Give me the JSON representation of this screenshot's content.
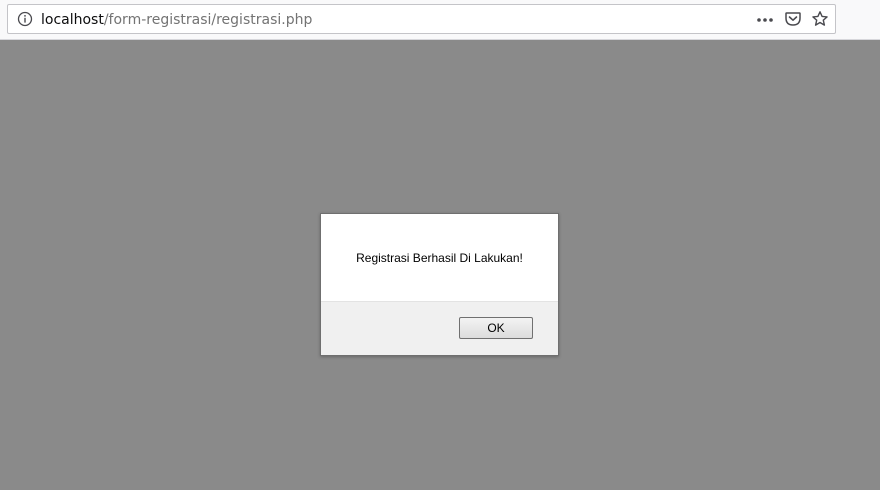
{
  "browser": {
    "url_host": "localhost",
    "url_path": "/form-registrasi/registrasi.php",
    "icons": {
      "info": "info-icon",
      "page_actions": "page-actions-icon",
      "pocket": "pocket-icon",
      "bookmark": "star-icon"
    }
  },
  "dialog": {
    "message": "Registrasi Berhasil Di Lakukan!",
    "ok_label": "OK"
  },
  "colors": {
    "overlay": "#8a8a8a",
    "dialog_footer": "#f0f0f0",
    "toolbar": "#f9f9fa"
  }
}
